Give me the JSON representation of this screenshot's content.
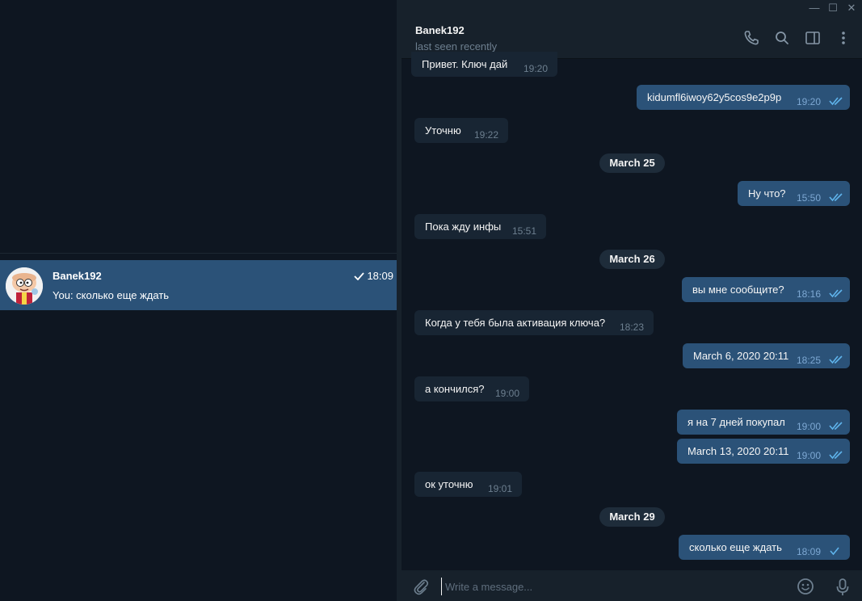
{
  "window": {
    "minimize_glyph": "—",
    "maximize_glyph": "☐",
    "close_glyph": "✕"
  },
  "chat_list": {
    "items": [
      {
        "name": "Banek192",
        "preview": "You: сколько еще ждать",
        "time": "18:09",
        "status": "sent-check",
        "avatar": "cartoon-character-avatar"
      }
    ]
  },
  "header": {
    "name": "Banek192",
    "status": "last seen recently",
    "icons": [
      "phone-icon",
      "search-icon",
      "sidebar-toggle-icon",
      "more-vertical-icon"
    ]
  },
  "messages": [
    {
      "dir": "in",
      "text": "Привет. Ключ дай",
      "time": "19:20"
    },
    {
      "dir": "out",
      "text": "kidumfl6iwoy62y5cos9e2p9p",
      "time": "19:20",
      "read": true
    },
    {
      "dir": "in",
      "text": "Уточню",
      "time": "19:22"
    },
    {
      "date": "March 25"
    },
    {
      "dir": "out",
      "text": "Ну что?",
      "time": "15:50",
      "read": true
    },
    {
      "dir": "in",
      "text": "Пока жду инфы",
      "time": "15:51"
    },
    {
      "date": "March 26"
    },
    {
      "dir": "out",
      "text": "вы мне сообщите?",
      "time": "18:16",
      "read": true
    },
    {
      "dir": "in",
      "text": "Когда у тебя была активация ключа?",
      "time": "18:23"
    },
    {
      "dir": "out",
      "text": "March 6, 2020 20:11",
      "time": "18:25",
      "read": true
    },
    {
      "dir": "in",
      "text": "а кончился?",
      "time": "19:00"
    },
    {
      "dir": "out",
      "text": "я на 7 дней покупал",
      "time": "19:00",
      "read": true
    },
    {
      "dir": "out",
      "text": "March 13, 2020 20:11",
      "time": "19:00",
      "read": true
    },
    {
      "dir": "in",
      "text": "ок уточню",
      "time": "19:01"
    },
    {
      "date": "March 29"
    },
    {
      "dir": "out",
      "text": "сколько еще ждать",
      "time": "18:09",
      "read": false
    }
  ],
  "composer": {
    "placeholder": "Write a message...",
    "value": ""
  },
  "colors": {
    "background": "#0e1621",
    "panel": "#17212b",
    "incoming_bubble": "#182533",
    "outgoing_bubble": "#2b5278",
    "selected_chat": "#2b5278",
    "read_check": "#5fb4ec",
    "muted_text": "#6d7f8f"
  }
}
